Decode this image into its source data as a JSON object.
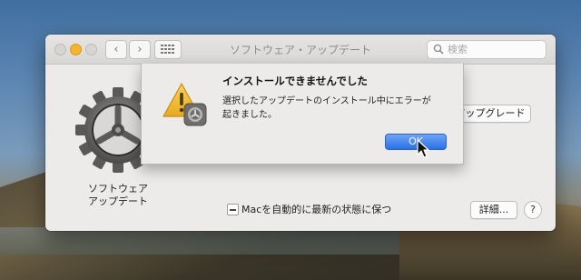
{
  "window": {
    "title": "ソフトウェア・アップデート",
    "search_placeholder": "検索",
    "nav_back": "‹",
    "nav_forward": "›"
  },
  "main": {
    "app_label_line1": "ソフトウェア",
    "app_label_line2": "アップデート",
    "upgrade_button": "アップグレード",
    "auto_update_label": "Macを自動的に最新の状態に保つ",
    "auto_update_state": "mixed",
    "details_button": "詳細...",
    "help_button": "?"
  },
  "alert": {
    "title": "インストールできませんでした",
    "message": "選択したアップデートのインストール中にエラーが起きました。",
    "ok_button": "OK"
  },
  "colors": {
    "accent": "#2a70e6",
    "minimize": "#f3b42e",
    "warning": "#f2c12e"
  }
}
